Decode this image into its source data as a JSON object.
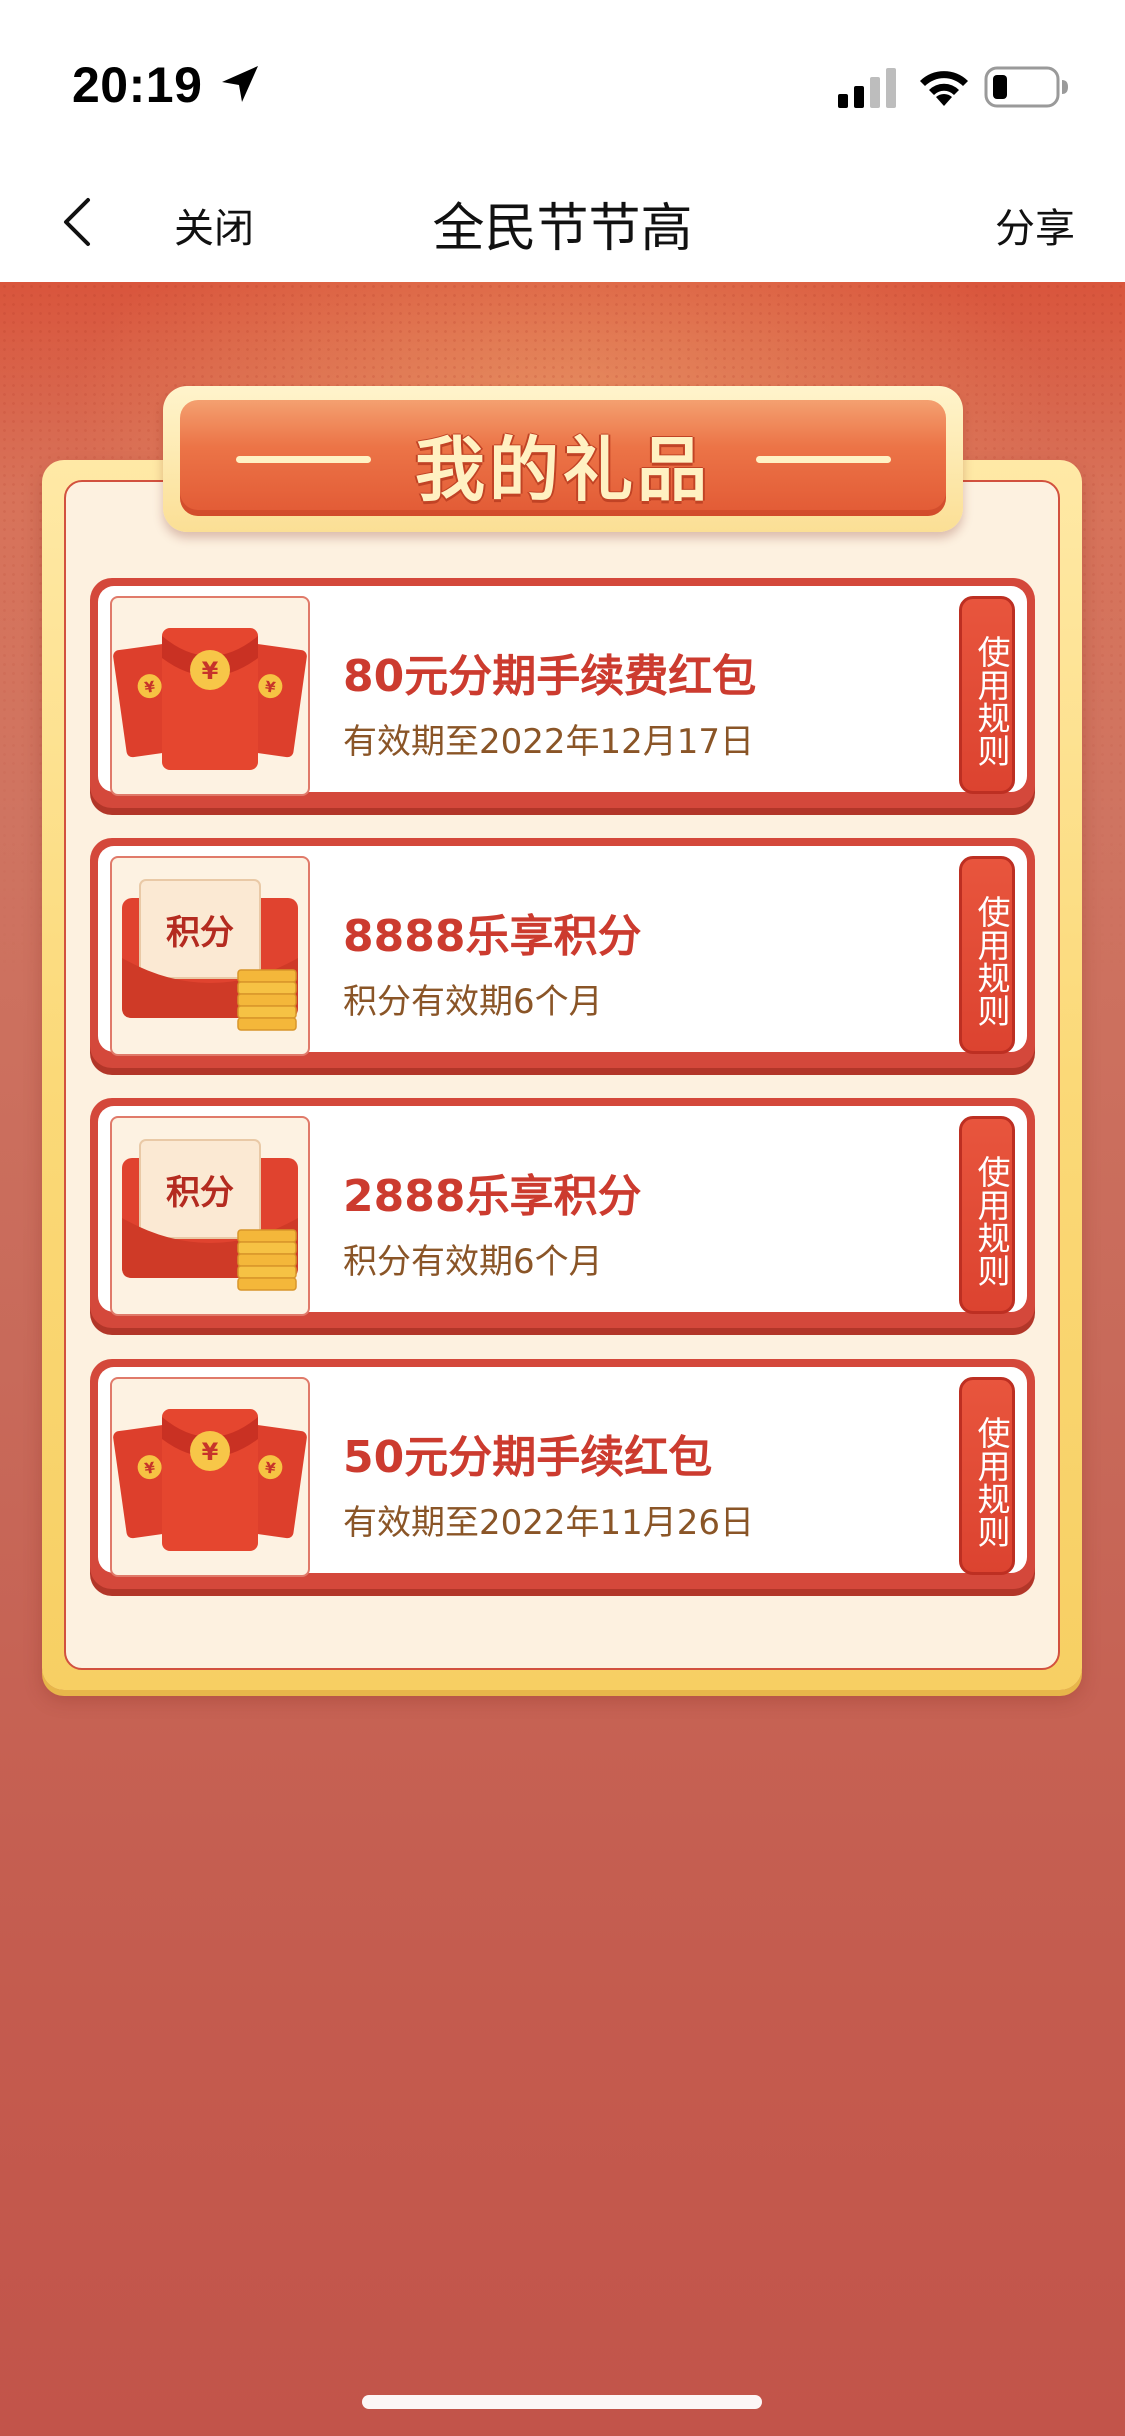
{
  "status_bar": {
    "time": "20:19"
  },
  "nav": {
    "close_label": "关闭",
    "title": "全民节节高",
    "share_label": "分享"
  },
  "banner": {
    "title": "我的礼品"
  },
  "gifts": [
    {
      "title": "80元分期手续费红包",
      "subtitle": "有效期至2022年12月17日",
      "icon": "red-envelope-icon",
      "rule_label": "使用规则"
    },
    {
      "title": "8888乐享积分",
      "subtitle": "积分有效期6个月",
      "icon": "points-icon",
      "icon_text": "积分",
      "rule_label": "使用规则"
    },
    {
      "title": "2888乐享积分",
      "subtitle": "积分有效期6个月",
      "icon": "points-icon",
      "icon_text": "积分",
      "rule_label": "使用规则"
    },
    {
      "title": "50元分期手续红包",
      "subtitle": "有效期至2022年11月26日",
      "icon": "red-envelope-icon",
      "rule_label": "使用规则"
    }
  ],
  "colors": {
    "accent_red": "#cc3b2f",
    "subtitle_brown": "#8a5527",
    "panel_gold": "#fbd978",
    "panel_cream": "#fdf1e0"
  }
}
